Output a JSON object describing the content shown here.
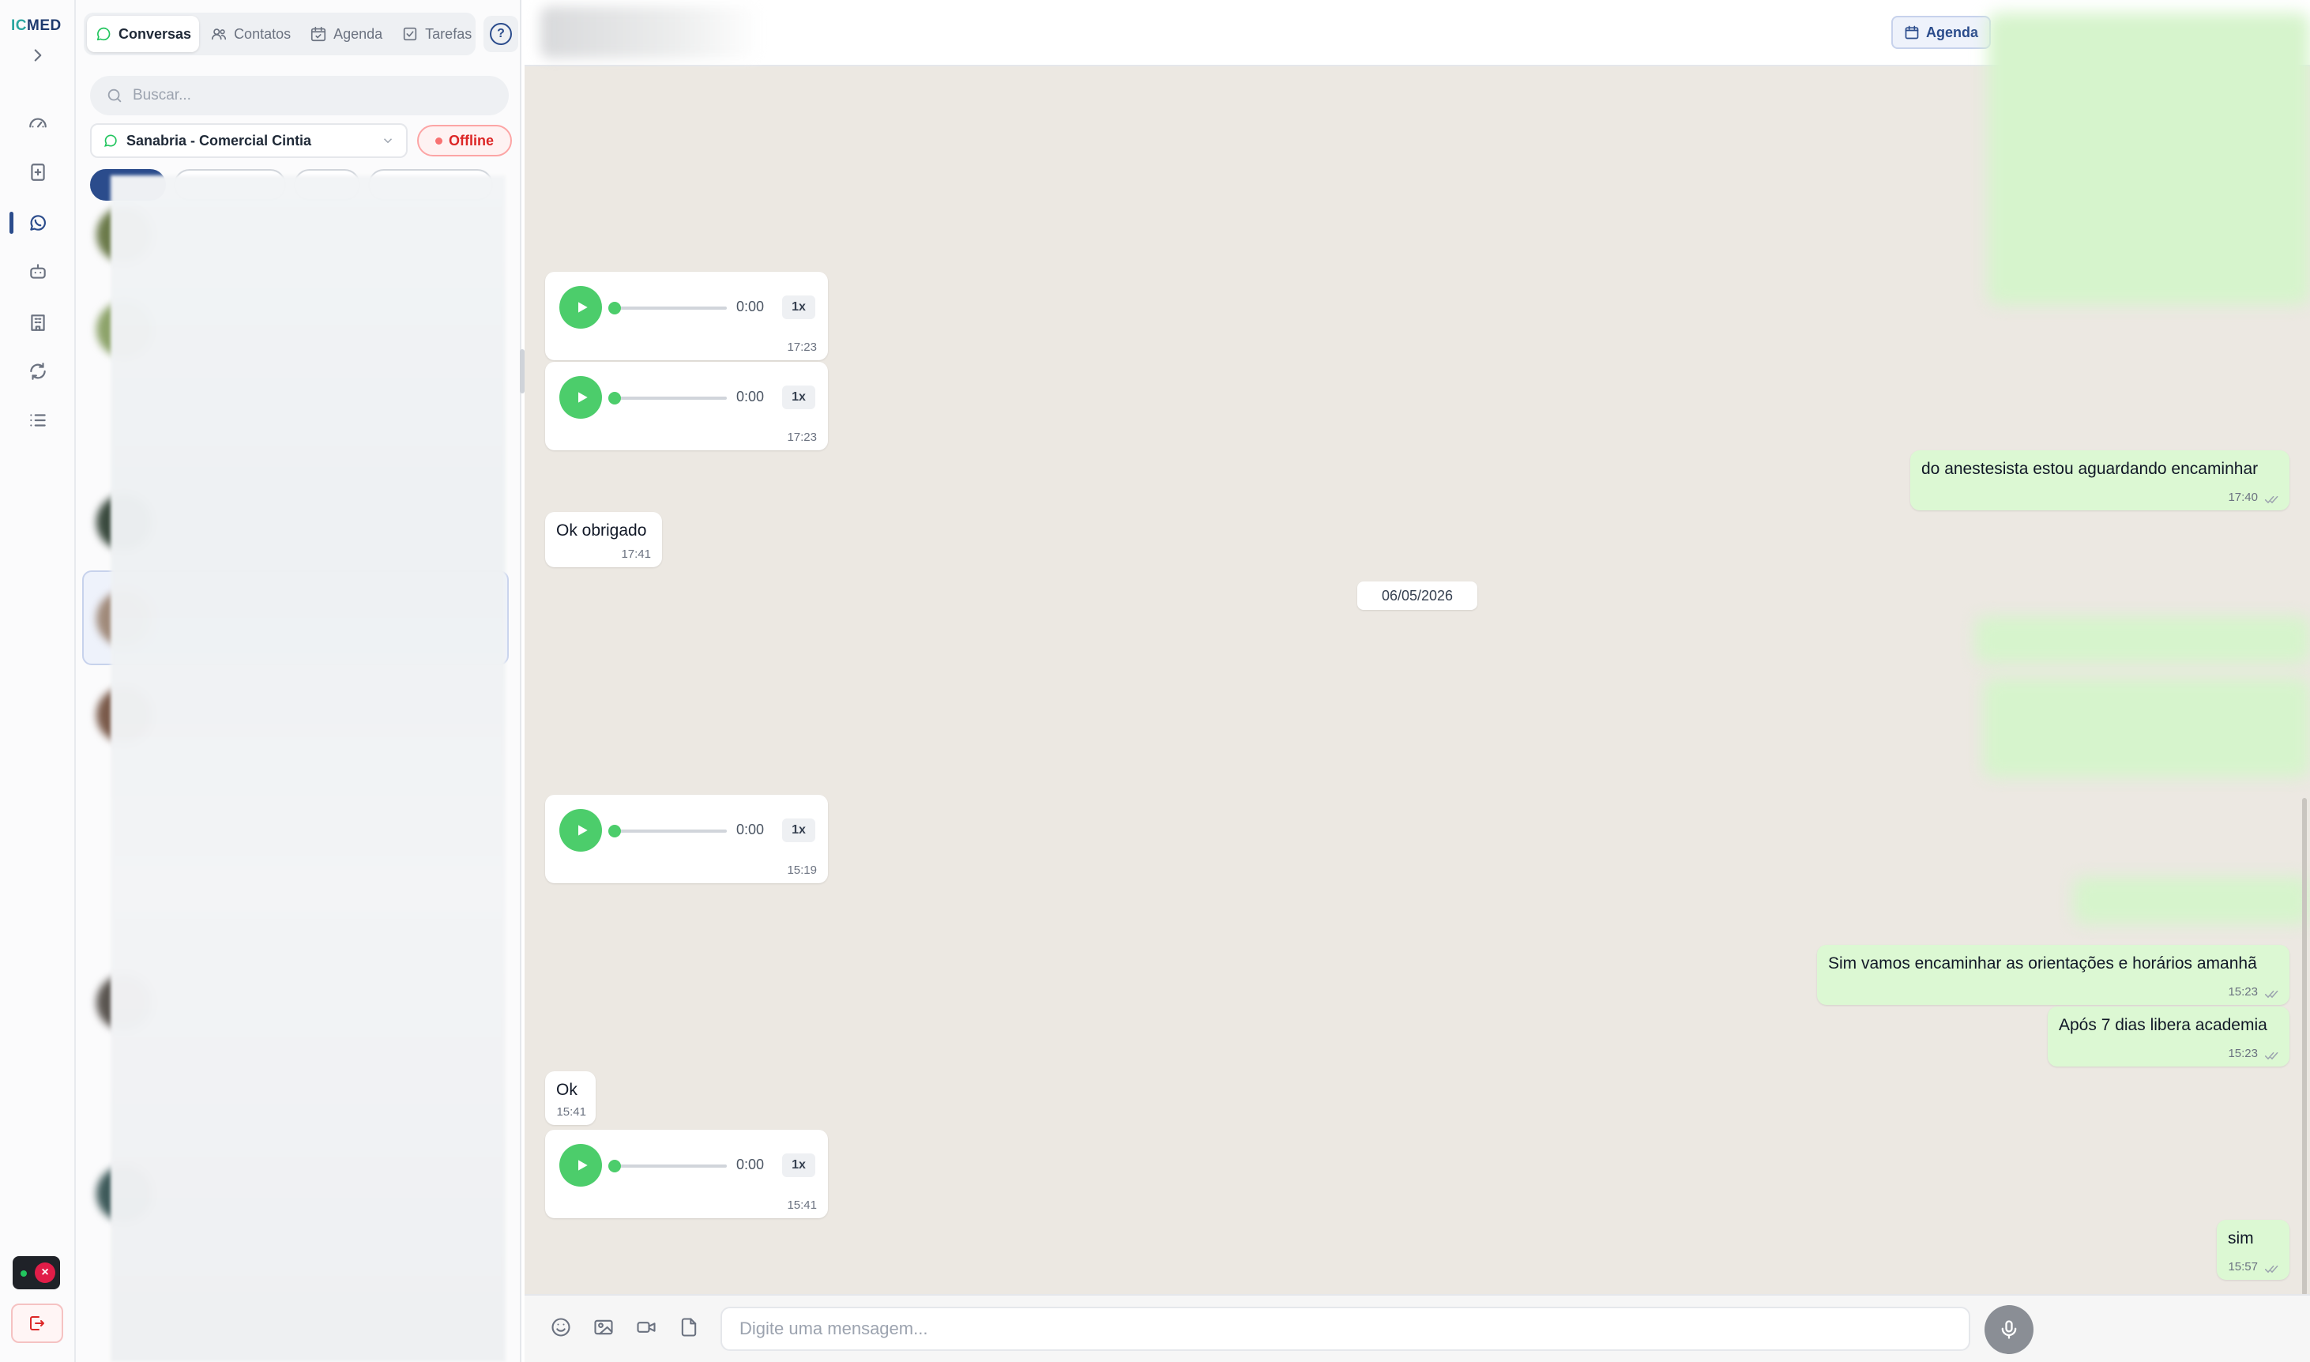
{
  "app": {
    "logo_ic": "IC",
    "logo_med": "MED"
  },
  "rail": {
    "items": [
      "dashboard-icon",
      "notes-icon",
      "whatsapp-icon",
      "bot-icon",
      "building-icon",
      "sync-icon",
      "list-icon"
    ],
    "active": "whatsapp-icon"
  },
  "tabs": {
    "conversas": "Conversas",
    "contatos": "Contatos",
    "agenda": "Agenda",
    "tarefas": "Tarefas",
    "help": "?"
  },
  "search": {
    "placeholder": "Buscar..."
  },
  "channel": {
    "name": "Sanabria - Comercial Cintia",
    "status": "Offline"
  },
  "header": {
    "agenda_label": "Agenda"
  },
  "messages": {
    "audio1": {
      "duration": "0:00",
      "speed": "1x",
      "time": "17:23"
    },
    "audio2": {
      "duration": "0:00",
      "speed": "1x",
      "time": "17:23"
    },
    "out1": {
      "text": "do anestesista estou aguardando encaminhar",
      "time": "17:40"
    },
    "in1": {
      "text": "Ok obrigado",
      "time": "17:41"
    },
    "date_separator": "06/05/2026",
    "audio3": {
      "duration": "0:00",
      "speed": "1x",
      "time": "15:19"
    },
    "out2": {
      "text": "Sim vamos encaminhar as orientações e horários amanhã",
      "time": "15:23"
    },
    "out3": {
      "text": "Após 7 dias libera academia",
      "time": "15:23"
    },
    "in2": {
      "text": "Ok",
      "time": "15:41"
    },
    "audio4": {
      "duration": "0:00",
      "speed": "1x",
      "time": "15:41"
    },
    "out4": {
      "text": "sim",
      "time": "15:57"
    }
  },
  "composer": {
    "placeholder": "Digite uma mensagem..."
  },
  "colors": {
    "brand": "#2b4c8c",
    "whatsapp_green": "#4ccd6b",
    "outgoing_bubble": "#dcf8d3",
    "chat_bg": "#ece8e2",
    "offline_red": "#dc2626"
  }
}
